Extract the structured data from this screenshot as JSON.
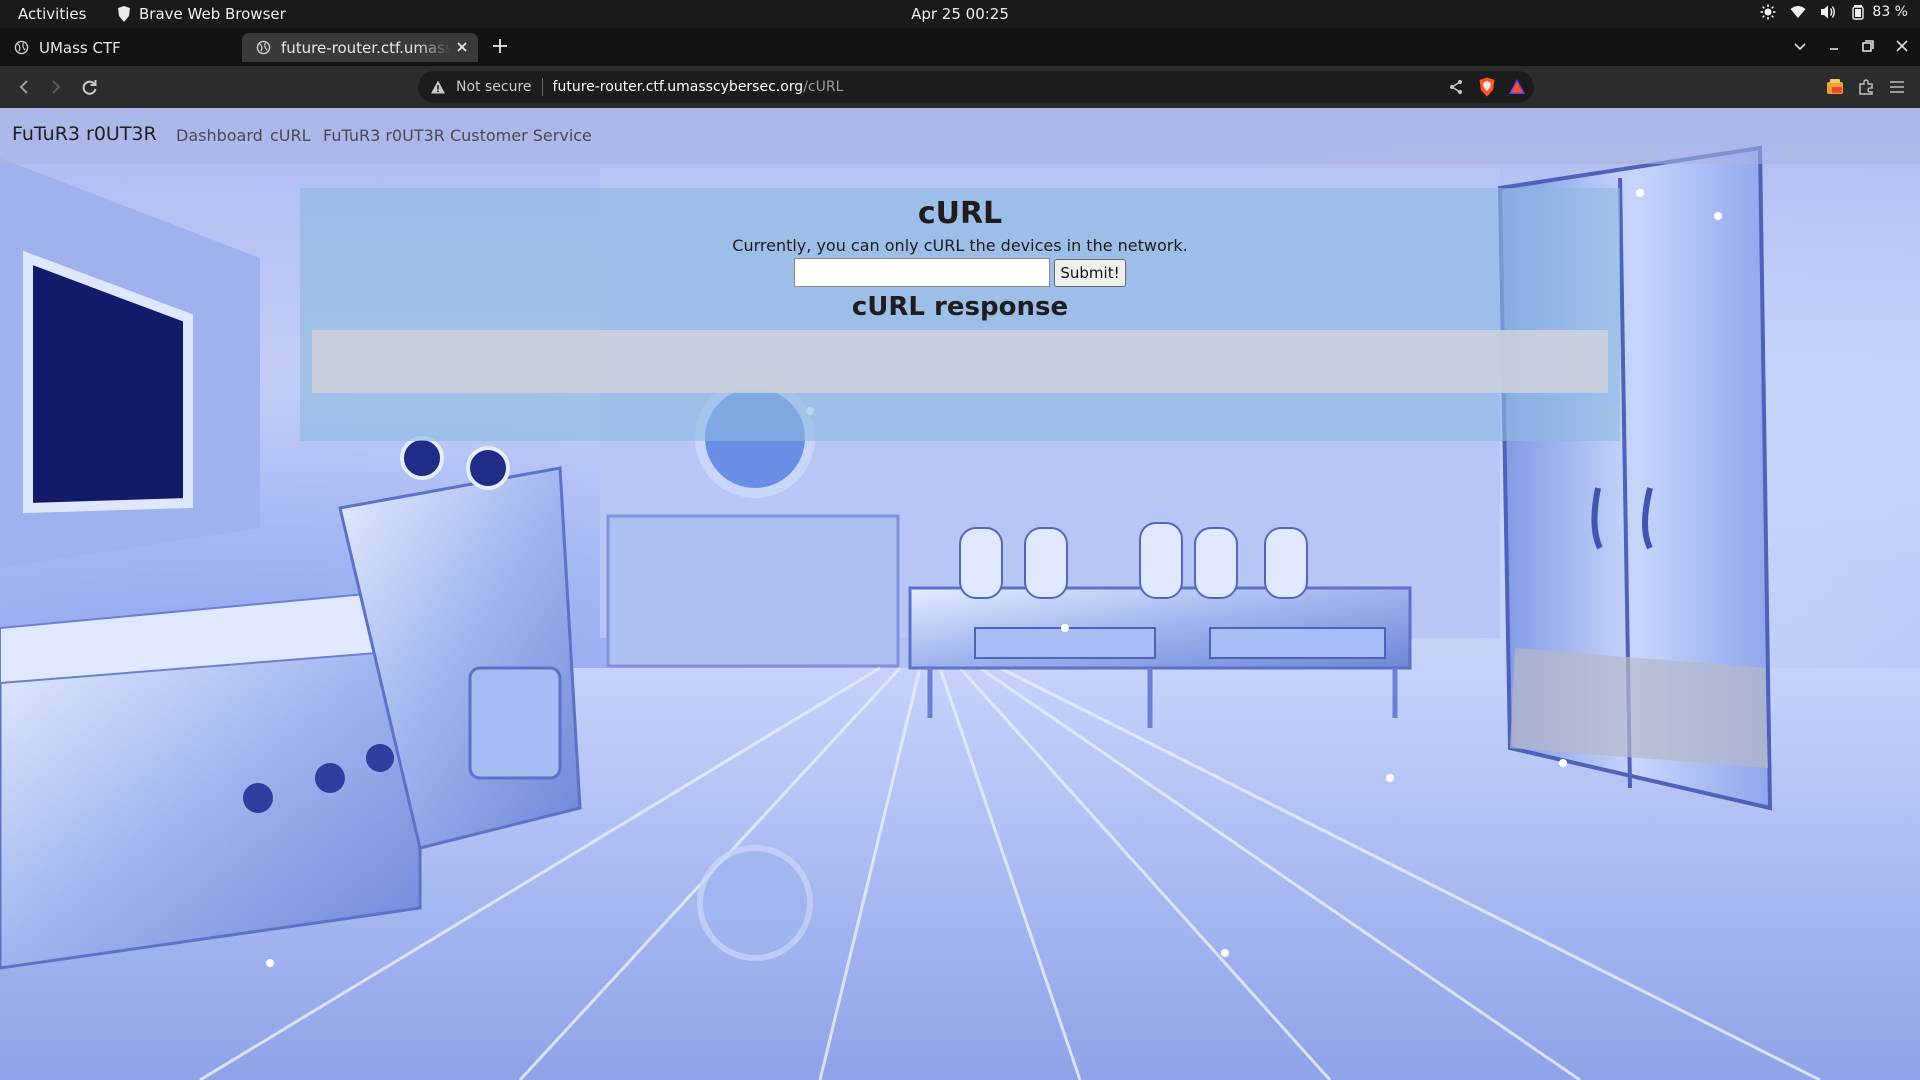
{
  "os": {
    "activities": "Activities",
    "app_name": "Brave Web Browser",
    "clock": "Apr 25  00:25",
    "battery": "83 %"
  },
  "browser": {
    "tabs": [
      {
        "title": "UMass CTF",
        "icon": "globe-icon"
      },
      {
        "title": "future-router.ctf.umasscybersec.org/cURL",
        "icon": "globe-icon"
      }
    ],
    "url": {
      "security": "Not secure",
      "host": "future-router.ctf.umasscybersec.org",
      "path": "/cURL"
    }
  },
  "site": {
    "brand": "FuTuR3 r0UT3R",
    "nav": {
      "dashboard": "Dashboard",
      "curl": "cURL",
      "service": "FuTuR3 r0UT3R Customer Service"
    }
  },
  "main": {
    "title": "cURL",
    "description": "Currently, you can only cURL the devices in the network.",
    "input": {
      "value": "",
      "placeholder": ""
    },
    "submit_label": "Submit!",
    "response_title": "cURL response",
    "response_body": ""
  },
  "colors": {
    "accent_brave": "#fb542b",
    "panel": "#8cb9e1"
  }
}
